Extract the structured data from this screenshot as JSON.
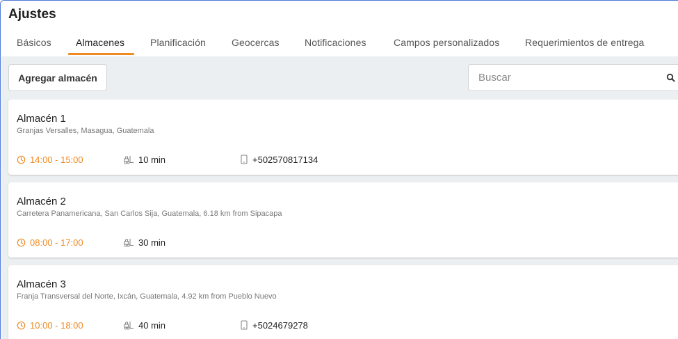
{
  "page": {
    "title": "Ajustes"
  },
  "tabs": [
    {
      "label": "Básicos"
    },
    {
      "label": "Almacenes",
      "active": true
    },
    {
      "label": "Planificación"
    },
    {
      "label": "Geocercas"
    },
    {
      "label": "Notificaciones"
    },
    {
      "label": "Campos personalizados"
    },
    {
      "label": "Requerimientos de entrega"
    }
  ],
  "toolbar": {
    "add_label": "Agregar almacén",
    "search_placeholder": "Buscar",
    "search_value": ""
  },
  "warehouses": [
    {
      "name": "Almacén 1",
      "address": "Granjas Versalles, Masagua, Guatemala",
      "hours": "14:00 - 15:00",
      "duration": "10 min",
      "phone": "+502570817134"
    },
    {
      "name": "Almacén 2",
      "address": "Carretera Panamericana, San Carlos Sija, Guatemala, 6.18 km from Sipacapa",
      "hours": "08:00 - 17:00",
      "duration": "30 min",
      "phone": ""
    },
    {
      "name": "Almacén 3",
      "address": "Franja Transversal del Norte, Ixcán, Guatemala, 4.92 km from Pueblo Nuevo",
      "hours": "10:00 - 18:00",
      "duration": "40 min",
      "phone": "+5024679278"
    }
  ],
  "icons": {
    "hours": "clock-icon",
    "duration": "forklift-icon",
    "phone": "phone-icon",
    "search": "search-icon"
  },
  "colors": {
    "accent": "#f08a24",
    "background": "#eceff1",
    "frame_border": "#4f7ad8"
  }
}
